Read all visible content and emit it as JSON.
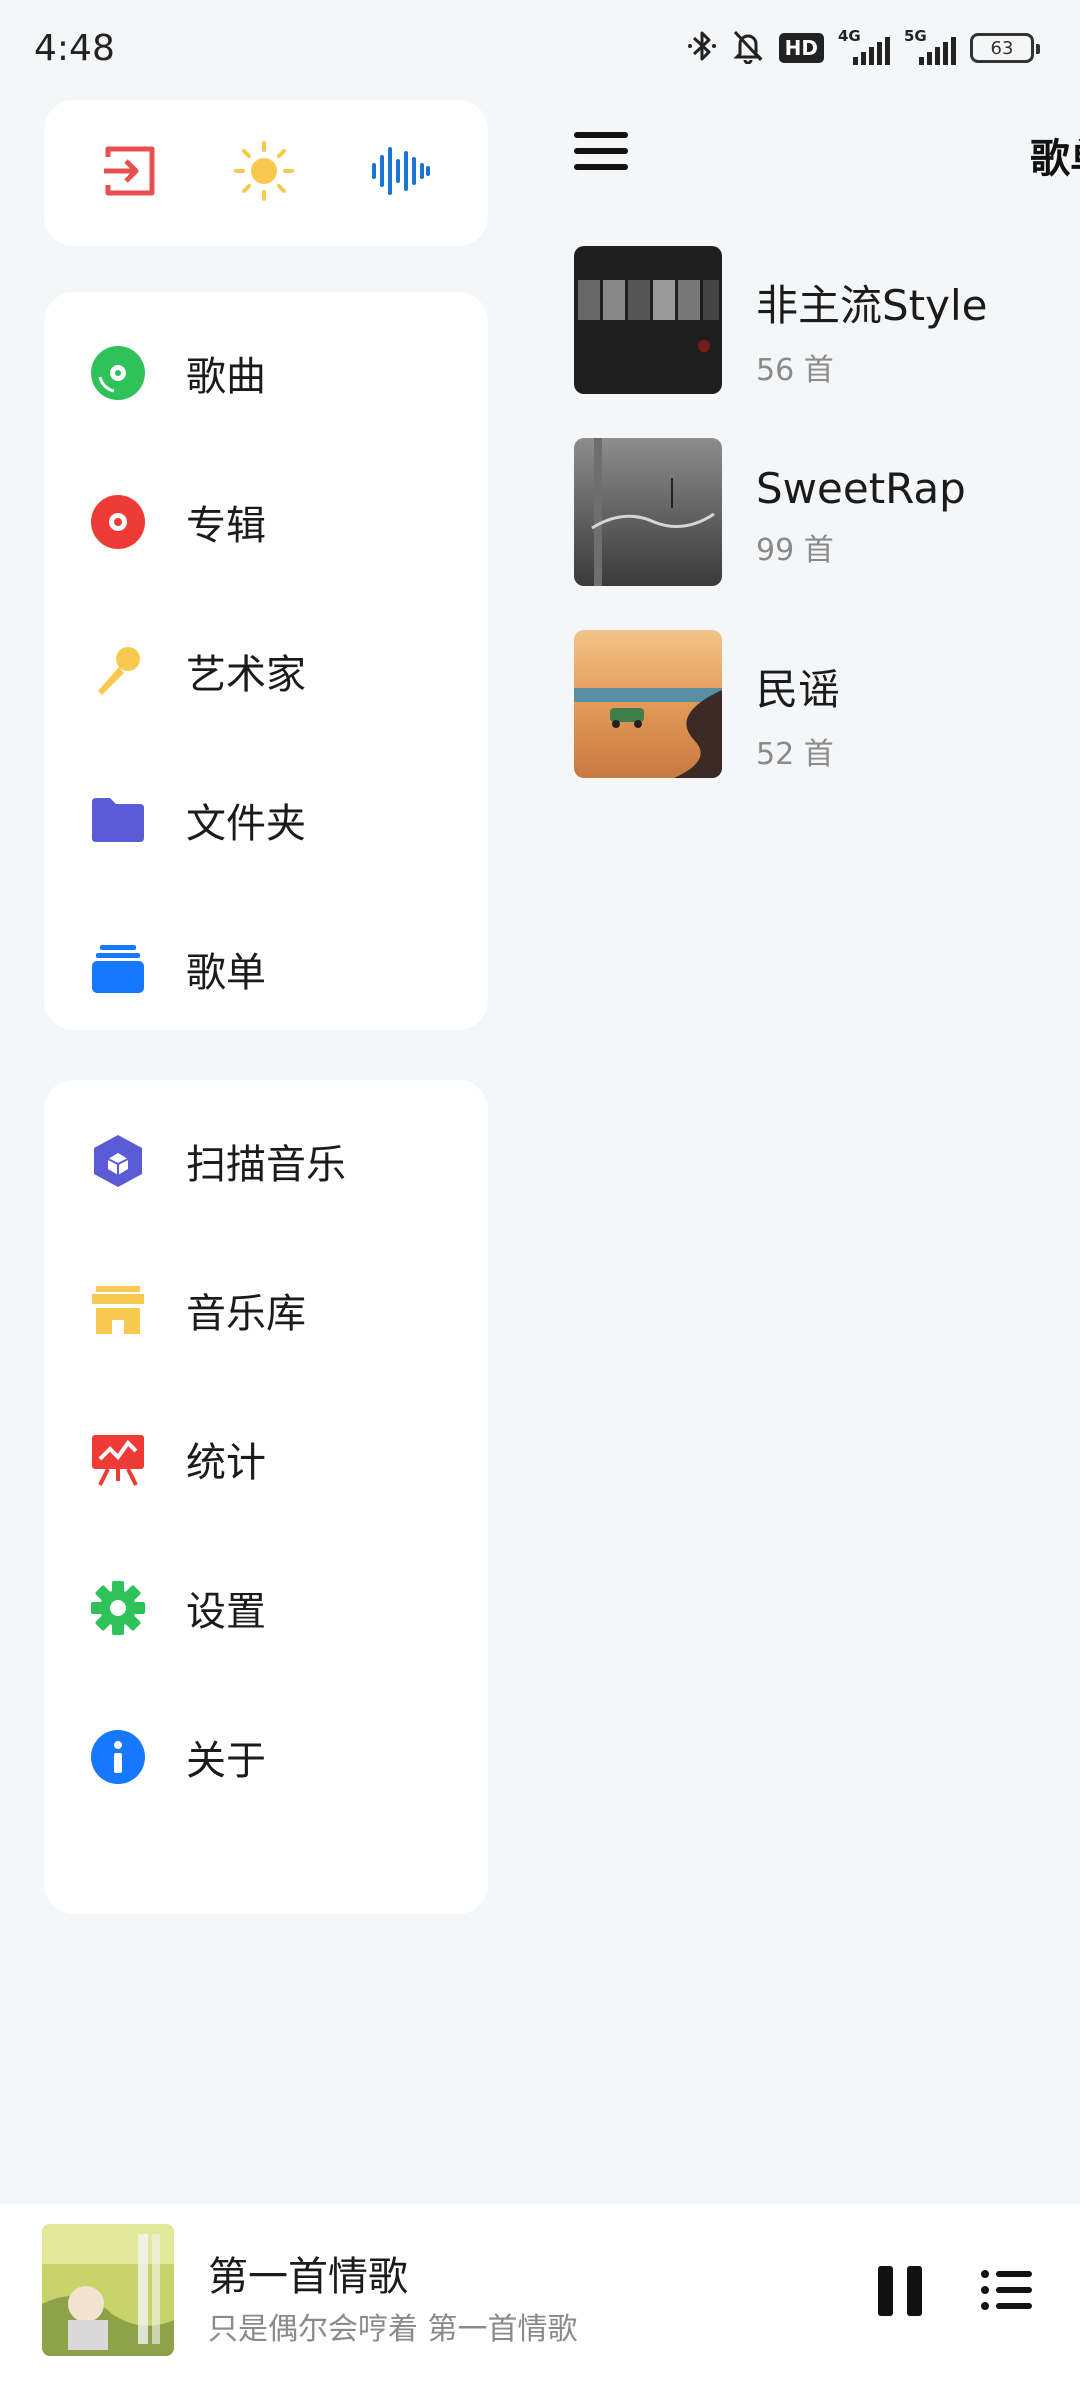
{
  "status_bar": {
    "time": "4:48",
    "hd_label": "HD",
    "net1_label": "4G",
    "net2_label": "5G",
    "battery": "63"
  },
  "drawer": {
    "quick_actions": [
      "exit-icon",
      "sun-icon",
      "waveform-icon"
    ],
    "nav_primary": [
      {
        "label": "歌曲",
        "icon": "song-disc-icon",
        "color": "#2fc25b"
      },
      {
        "label": "专辑",
        "icon": "album-disc-icon",
        "color": "#ef3b36"
      },
      {
        "label": "艺术家",
        "icon": "microphone-icon",
        "color": "#f9c850"
      },
      {
        "label": "文件夹",
        "icon": "folder-icon",
        "color": "#5c5bd6"
      },
      {
        "label": "歌单",
        "icon": "playlist-stack-icon",
        "color": "#1677ff"
      }
    ],
    "nav_secondary": [
      {
        "label": "扫描音乐",
        "icon": "scan-cube-icon",
        "color": "#5c5bd6"
      },
      {
        "label": "音乐库",
        "icon": "store-icon",
        "color": "#f9c850"
      },
      {
        "label": "统计",
        "icon": "chart-board-icon",
        "color": "#ef3b36"
      },
      {
        "label": "设置",
        "icon": "gear-icon",
        "color": "#2fc25b"
      },
      {
        "label": "关于",
        "icon": "info-icon",
        "color": "#1677ff"
      }
    ]
  },
  "main": {
    "title": "歌单",
    "playlists": [
      {
        "name": "非主流Style",
        "count": "56 首"
      },
      {
        "name": "SweetRap",
        "count": "99 首"
      },
      {
        "name": "民谣",
        "count": "52 首"
      }
    ]
  },
  "player": {
    "song": "第一首情歌",
    "lyric": "只是偶尔会哼着 第一首情歌"
  }
}
